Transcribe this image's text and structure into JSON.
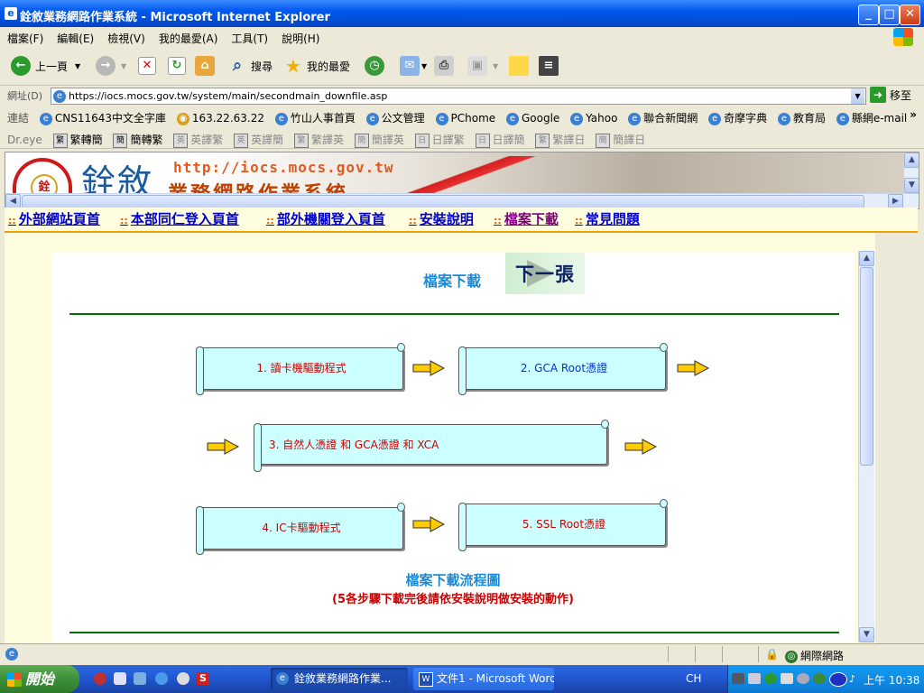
{
  "window": {
    "title": "銓敘業務網路作業系統 - Microsoft Internet Explorer"
  },
  "menu": [
    "檔案(F)",
    "編輯(E)",
    "檢視(V)",
    "我的最愛(A)",
    "工具(T)",
    "說明(H)"
  ],
  "toolbar": {
    "back": "上一頁",
    "search": "搜尋",
    "favorites": "我的最愛"
  },
  "address": {
    "label": "網址(D)",
    "url": "https://iocs.mocs.gov.tw/system/main/secondmain_downfile.asp",
    "go": "移至"
  },
  "links": {
    "label": "連結",
    "items": [
      "CNS11643中文全字庫",
      "163.22.63.22",
      "竹山人事首頁",
      "公文管理",
      "PChome",
      "Google",
      "Yahoo",
      "聯合新聞網",
      "奇摩字典",
      "教育局",
      "縣網e-mail"
    ],
    "more": "»"
  },
  "dreye": {
    "label": "Dr.eye",
    "items": [
      "繁轉簡",
      "簡轉繁",
      "英譯繁",
      "英譯簡",
      "繁譯英",
      "簡譯英",
      "日譯繁",
      "日譯簡",
      "繁譯日",
      "簡譯日"
    ]
  },
  "banner": {
    "url": "http://iocs.mocs.gov.tw",
    "logo_text": "銓敘",
    "subtitle": "業務網路作業系統"
  },
  "nav": [
    "外部網站頁首",
    "本部同仁登入頁首",
    "部外機關登入頁首",
    "安裝說明",
    "檔案下載",
    "常見問題"
  ],
  "main": {
    "heading": "檔案下載",
    "next_button": "下一張",
    "steps": [
      "1. 讀卡機驅動程式",
      "2. GCA Root憑證",
      "3. 自然人憑證 和 GCA憑證 和 XCA",
      "4. IC卡驅動程式",
      "5. SSL Root憑證"
    ],
    "caption": "檔案下載流程圖",
    "note": "(5各步驟下載完後請依安裝說明做安裝的動作)"
  },
  "status": {
    "zone": "網際網路"
  },
  "taskbar": {
    "start": "開始",
    "tasks": [
      "銓敘業務網路作業...",
      "文件1 - Microsoft Word"
    ],
    "lang": "CH",
    "clock": "上午 10:38"
  },
  "colors": {
    "step_text_red": "#cc0000",
    "step_text_blue": "#0033cc",
    "heading_blue": "#1a8ad8",
    "box_fill": "#ccffff",
    "rule_green": "#007000"
  }
}
